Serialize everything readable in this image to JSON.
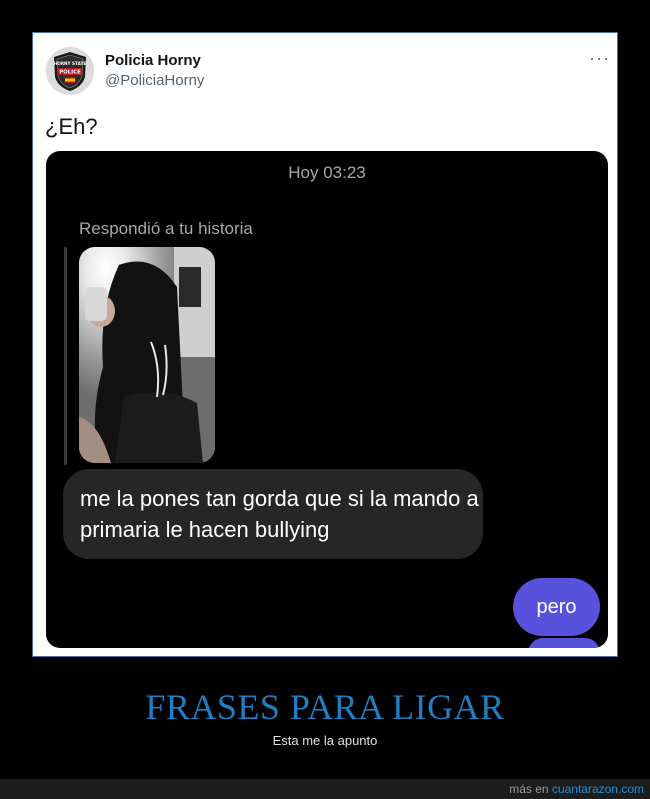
{
  "tweet": {
    "author_name": "Policia Horny",
    "author_handle": "@PoliciaHorny",
    "more_label": "···",
    "text": "¿Eh?",
    "avatar_icon": "police-badge-icon",
    "avatar_badge_lines": [
      "HORNY STATE",
      "POLICE"
    ]
  },
  "chat": {
    "timestamp": "Hoy 03:23",
    "replied_label": "Respondió a tu historia",
    "story_image": "story-photo",
    "incoming_message": "me la pones tan gorda que si la mando a primaria le hacen bullying",
    "outgoing_message": "pero",
    "outgoing_color": "#5851db"
  },
  "caption": {
    "title": "FRASES PARA LIGAR",
    "subtitle": "Esta me la apunto"
  },
  "footer": {
    "prefix": "más en ",
    "site": "cuantarazon.com"
  },
  "colors": {
    "caption_title": "#1f7fc4",
    "frame_border": "#4a6fa5"
  }
}
